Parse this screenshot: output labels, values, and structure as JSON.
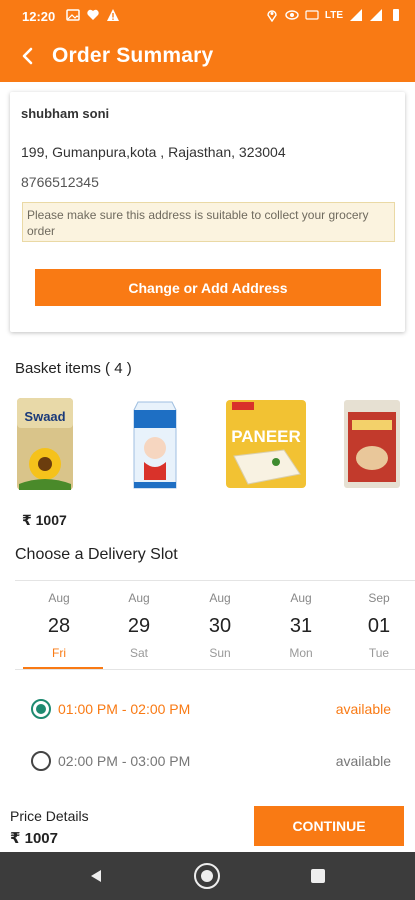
{
  "status_bar": {
    "time": "12:20",
    "network": "LTE"
  },
  "header": {
    "title": "Order Summary"
  },
  "address": {
    "name": "shubham soni",
    "line": "199, Gumanpura,kota , Rajasthan, 323004",
    "phone": "8766512345",
    "note": "Please make sure this address is suitable to collect your grocery order",
    "change_button": "Change or Add Address"
  },
  "basket": {
    "title": "Basket items ( 4 )",
    "items": [
      {
        "name": "Swaad",
        "kind": "oil-pouch-image"
      },
      {
        "name": "",
        "kind": "milk-carton-image"
      },
      {
        "name": "PANEER",
        "kind": "paneer-pack-image"
      },
      {
        "name": "",
        "kind": "atta-bag-image"
      }
    ],
    "total": "₹ 1007"
  },
  "delivery": {
    "title": "Choose a Delivery Slot",
    "dates": [
      {
        "month": "Aug",
        "day": "28",
        "weekday": "Fri",
        "selected": true
      },
      {
        "month": "Aug",
        "day": "29",
        "weekday": "Sat",
        "selected": false
      },
      {
        "month": "Aug",
        "day": "30",
        "weekday": "Sun",
        "selected": false
      },
      {
        "month": "Aug",
        "day": "31",
        "weekday": "Mon",
        "selected": false
      },
      {
        "month": "Sep",
        "day": "01",
        "weekday": "Tue",
        "selected": false
      }
    ],
    "slots": [
      {
        "time": "01:00 PM - 02:00 PM",
        "status": "available",
        "selected": true
      },
      {
        "time": "02:00 PM - 03:00 PM",
        "status": "available",
        "selected": false
      }
    ]
  },
  "footer": {
    "price_label": "Price Details",
    "price_value": "₹ 1007",
    "continue_label": "CONTINUE"
  },
  "colors": {
    "accent": "#f97a14",
    "radio_selected": "#1e8a70",
    "navbar": "#3c3c3c"
  }
}
